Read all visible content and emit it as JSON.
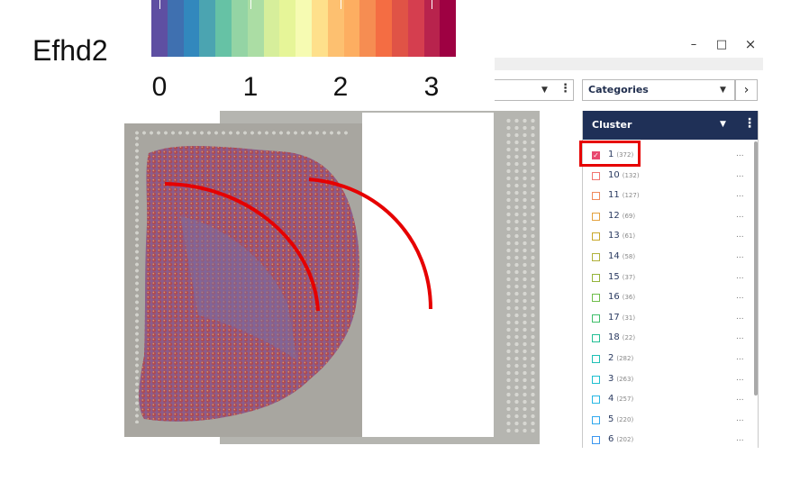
{
  "gene": {
    "name": "Efhd2"
  },
  "colorbar": {
    "colors": [
      "#5e4fa2",
      "#3f70b0",
      "#3288bd",
      "#4ba4b1",
      "#66c2a5",
      "#94d4a4",
      "#abdda4",
      "#d6ee9b",
      "#e6f598",
      "#f6fbb2",
      "#fee08b",
      "#fdc070",
      "#fdae61",
      "#f68d52",
      "#f46d43",
      "#e05346",
      "#d53e4f",
      "#b8234d",
      "#9e0142"
    ],
    "labels": [
      "0",
      "1",
      "2",
      "3"
    ]
  },
  "window": {
    "minimize_glyph": "–",
    "maximize_glyph": "□",
    "close_glyph": "×"
  },
  "toolbar": {
    "left_dropdown": {
      "caret_icon": "caret-down-icon",
      "menu_icon": "kebab-icon"
    },
    "categories_dropdown": {
      "value": "Categories",
      "caret_icon": "caret-down-icon"
    },
    "next_icon": "chevron-right-icon"
  },
  "cluster_panel": {
    "title": "Cluster",
    "colors": {
      "header": "#1f3057",
      "text": "#2a3a60"
    },
    "items": [
      {
        "label": "1",
        "count": "(372)",
        "checked": true,
        "color": "#e8476f"
      },
      {
        "label": "10",
        "count": "(132)",
        "checked": false,
        "color": "#f2756f"
      },
      {
        "label": "11",
        "count": "(127)",
        "checked": false,
        "color": "#f08a5b"
      },
      {
        "label": "12",
        "count": "(69)",
        "checked": false,
        "color": "#e4a23e"
      },
      {
        "label": "13",
        "count": "(61)",
        "checked": false,
        "color": "#c9a82b"
      },
      {
        "label": "14",
        "count": "(58)",
        "checked": false,
        "color": "#b0b13a"
      },
      {
        "label": "15",
        "count": "(37)",
        "checked": false,
        "color": "#94b43b"
      },
      {
        "label": "16",
        "count": "(36)",
        "checked": false,
        "color": "#6ebd4a"
      },
      {
        "label": "17",
        "count": "(31)",
        "checked": false,
        "color": "#3fbe6a"
      },
      {
        "label": "18",
        "count": "(22)",
        "checked": false,
        "color": "#23bf94"
      },
      {
        "label": "2",
        "count": "(282)",
        "checked": false,
        "color": "#1ec0b5"
      },
      {
        "label": "3",
        "count": "(263)",
        "checked": false,
        "color": "#1dbfd0"
      },
      {
        "label": "4",
        "count": "(257)",
        "checked": false,
        "color": "#27b7e4"
      },
      {
        "label": "5",
        "count": "(220)",
        "checked": false,
        "color": "#2fa8ee"
      },
      {
        "label": "6",
        "count": "(202)",
        "checked": false,
        "color": "#3a96f0"
      }
    ],
    "more_glyph": "..."
  },
  "annotation": {
    "color": "#e60000"
  }
}
